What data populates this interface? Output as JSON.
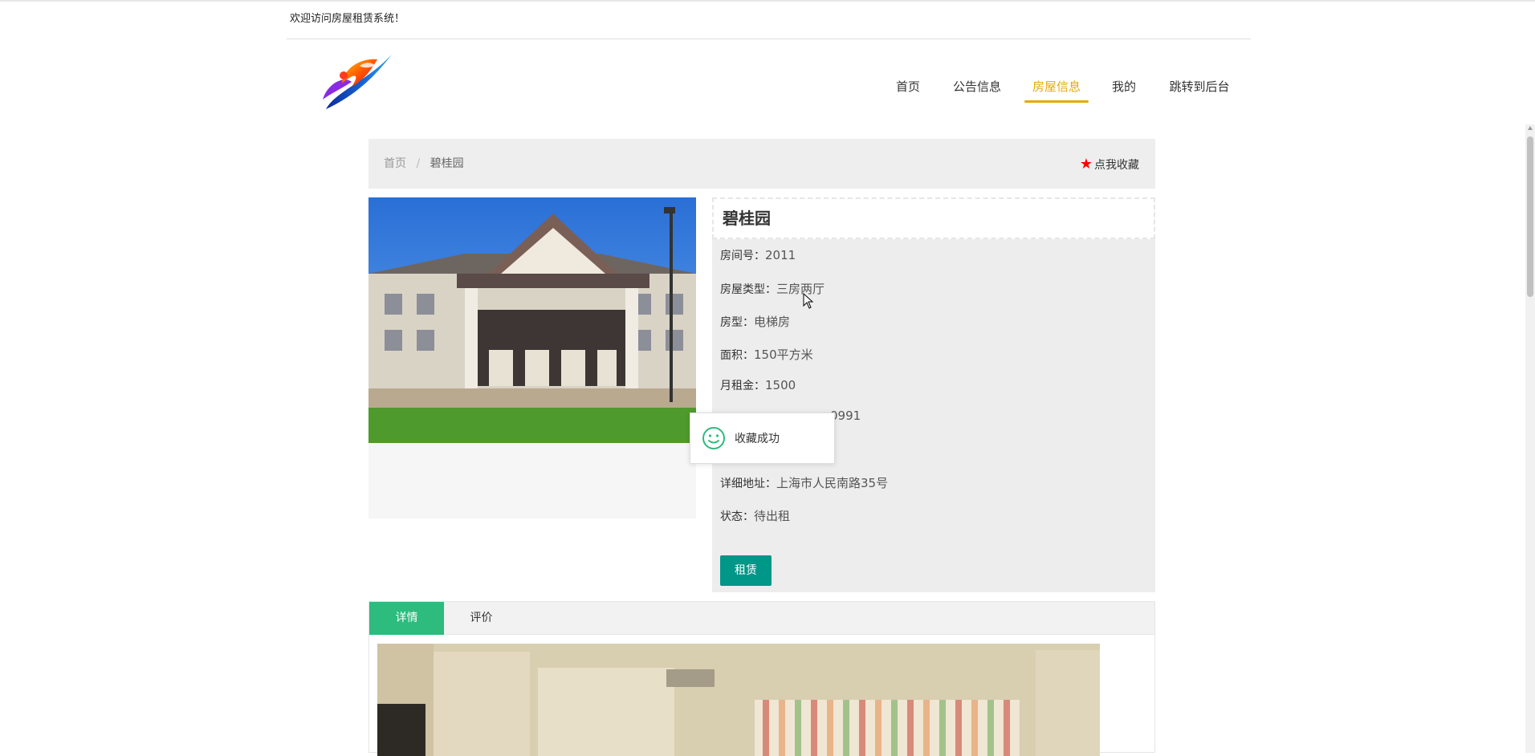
{
  "header": {
    "welcome": "欢迎访问房屋租赁系统！"
  },
  "nav": {
    "items": [
      {
        "label": "首页"
      },
      {
        "label": "公告信息"
      },
      {
        "label": "房屋信息"
      },
      {
        "label": "我的"
      },
      {
        "label": "跳转到后台"
      }
    ],
    "active_index": 2
  },
  "breadcrumb": {
    "home": "首页",
    "separator": "/",
    "current": "碧桂园"
  },
  "favorite": {
    "icon": "star-icon",
    "label": "点我收藏"
  },
  "house": {
    "title": "碧桂园",
    "fields": [
      {
        "key": "房间号：",
        "value": "2011"
      },
      {
        "key": "房屋类型：",
        "value": "三房两厅"
      },
      {
        "key": "房型：",
        "value": "电梯房"
      },
      {
        "key": "面积：",
        "value": "150平方米"
      },
      {
        "key": "月租金：",
        "value": "1500"
      },
      {
        "key": "",
        "value": "0991"
      },
      {
        "key": "详细地址：",
        "value": "上海市人民南路35号"
      },
      {
        "key": "状态：",
        "value": "待出租"
      }
    ],
    "rent_button": "租赁"
  },
  "toast": {
    "icon": "smile-icon",
    "message": "收藏成功"
  },
  "tabs": [
    {
      "label": "详情"
    },
    {
      "label": "评价"
    }
  ],
  "colors": {
    "nav_active": "#e6a90b",
    "rent_button": "#009688",
    "tab_active": "#2dbb7e",
    "star": "#ff0000",
    "toast_icon": "#2dbb7e"
  }
}
